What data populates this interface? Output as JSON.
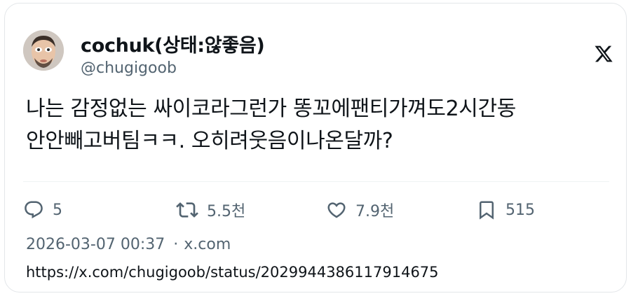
{
  "author": {
    "display_name": "cochuk(상태:않좋음)",
    "handle": "@chugigoob",
    "avatar_icon": "face-avatar"
  },
  "platform": {
    "logo_icon": "x-logo-icon"
  },
  "tweet": {
    "lines": [
      "나는 감정없는 싸이코라그런가 똥꼬에팬티가껴도2시간동",
      "안안빼고버팀ㅋㅋ. 오히려웃음이나온달까?"
    ]
  },
  "actions": {
    "reply": {
      "icon": "reply-icon",
      "count": "5"
    },
    "retweet": {
      "icon": "retweet-icon",
      "count": "5.5천"
    },
    "like": {
      "icon": "heart-icon",
      "count": "7.9천"
    },
    "bookmark": {
      "icon": "bookmark-icon",
      "count": "515"
    }
  },
  "meta": {
    "timestamp": "2026-03-07 00:37",
    "separator": "·",
    "source": "x.com"
  },
  "link": {
    "url": "https://x.com/chugigoob/status/2029944386117914675"
  },
  "colors": {
    "text_primary": "#0f1419",
    "text_secondary": "#536471",
    "border": "#e3e6e9"
  }
}
